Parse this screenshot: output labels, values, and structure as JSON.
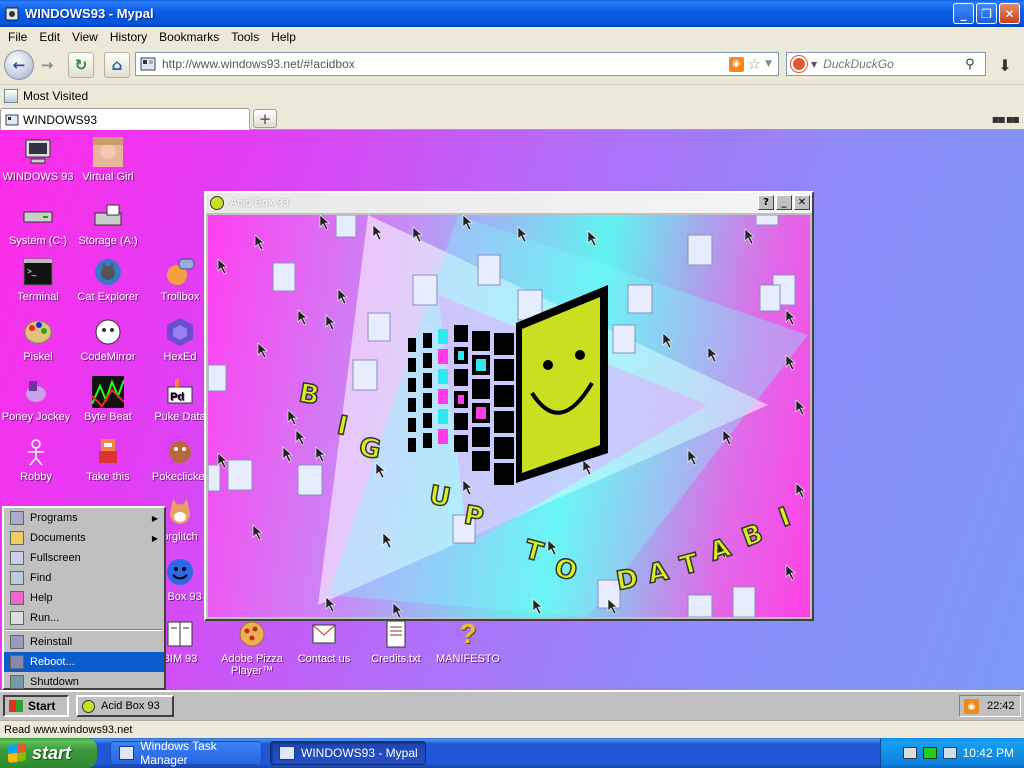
{
  "window": {
    "title": "WINDOWS93 - Mypal"
  },
  "menu": [
    "File",
    "Edit",
    "View",
    "History",
    "Bookmarks",
    "Tools",
    "Help"
  ],
  "nav": {
    "url": "http://www.windows93.net/#!acidbox",
    "search_placeholder": "DuckDuckGo"
  },
  "bookmarks": {
    "most_visited": "Most Visited"
  },
  "tabs": [
    {
      "label": "WINDOWS93"
    }
  ],
  "desktop_icons": [
    {
      "label": "WINDOWS 93",
      "icon": "computer-icon"
    },
    {
      "label": "Virtual Girl",
      "icon": "virtual-girl-icon"
    },
    {
      "label": "System (C:)",
      "icon": "drive-icon"
    },
    {
      "label": "Storage (A:)",
      "icon": "floppy-icon"
    },
    {
      "label": "Terminal",
      "icon": "terminal-icon"
    },
    {
      "label": "Cat Explorer",
      "icon": "cat-explorer-icon"
    },
    {
      "label": "Trollbox",
      "icon": "trollbox-icon"
    },
    {
      "label": "Piskel",
      "icon": "palette-icon"
    },
    {
      "label": "CodeMirror",
      "icon": "codemirror-icon"
    },
    {
      "label": "HexEd",
      "icon": "hexed-icon"
    },
    {
      "label": "Poney Jockey",
      "icon": "pony-icon"
    },
    {
      "label": "Byte Beat",
      "icon": "bytebeat-icon"
    },
    {
      "label": "Puke Data",
      "icon": "puke-data-icon"
    },
    {
      "label": "Robby",
      "icon": "robby-icon"
    },
    {
      "label": "Take this",
      "icon": "take-this-icon"
    },
    {
      "label": "Pokeclicker",
      "icon": "pokeclicker-icon"
    },
    {
      "label": "orglitch",
      "icon": "corgi-icon"
    },
    {
      "label": "d Box 93",
      "icon": "acid-box-icon"
    },
    {
      "label": "BIM 93",
      "icon": "bim-icon"
    },
    {
      "label": "Adobe Pizza Player™",
      "icon": "pizza-icon"
    },
    {
      "label": "Contact us",
      "icon": "contact-icon"
    },
    {
      "label": "Credits.txt",
      "icon": "text-file-icon"
    },
    {
      "label": "MANIFESTO",
      "icon": "question-icon"
    }
  ],
  "acidbox": {
    "title": "Acid Box 93",
    "help": "?",
    "minimize": "_",
    "close": "✕",
    "text_words": [
      "BIG",
      "UP",
      "TO",
      "DATA",
      "BI"
    ]
  },
  "w93_start_menu": [
    {
      "label": "Programs",
      "submenu": true,
      "icon": "programs-icon"
    },
    {
      "label": "Documents",
      "submenu": true,
      "icon": "documents-icon"
    },
    {
      "label": "Fullscreen",
      "icon": "fullscreen-icon"
    },
    {
      "label": "Find",
      "icon": "find-icon"
    },
    {
      "label": "Help",
      "icon": "help-icon"
    },
    {
      "label": "Run...",
      "icon": "run-icon"
    },
    {
      "label": "Reinstall",
      "icon": "reinstall-icon"
    },
    {
      "label": "Reboot...",
      "icon": "reboot-icon",
      "selected": true
    },
    {
      "label": "Shutdown",
      "icon": "shutdown-icon"
    }
  ],
  "w93_taskbar": {
    "start": "Start",
    "acid_task": "Acid Box 93",
    "clock": "22:42"
  },
  "status": "Read www.windows93.net",
  "xp_taskbar": {
    "start": "start",
    "task1": "Windows Task Manager",
    "task2": "WINDOWS93 - Mypal",
    "clock": "10:42 PM"
  },
  "colors": {
    "xp_blue": "#2157d7",
    "xp_start_green": "#3c9a3c",
    "w93_selected": "#0a5ccd",
    "acid_smile": "#c8e020"
  }
}
